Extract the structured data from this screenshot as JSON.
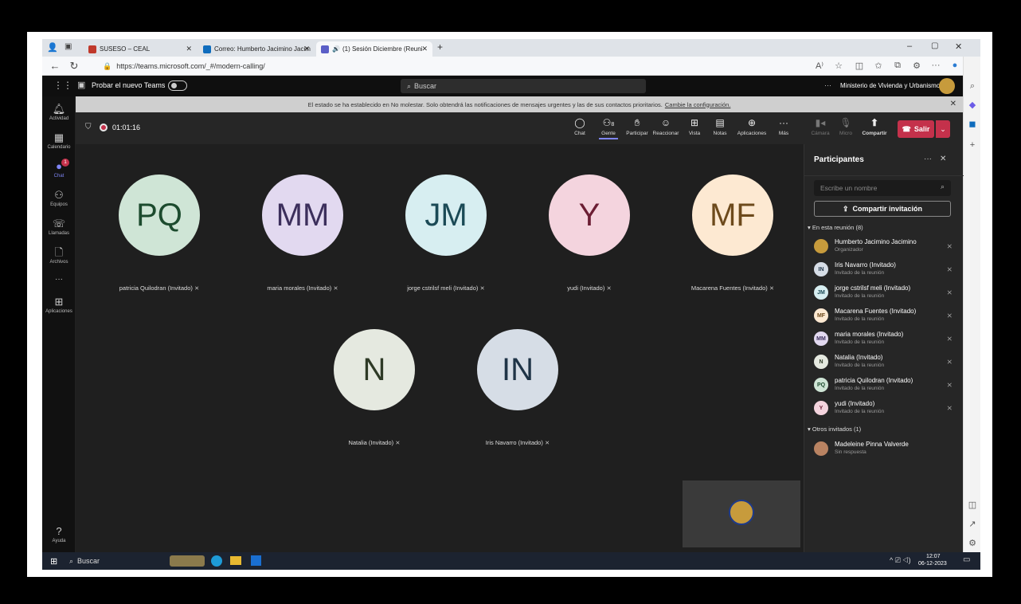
{
  "browser": {
    "tabs": [
      {
        "title": "SUSESO – CEAL"
      },
      {
        "title": "Correo: Humberto Jacimino Jacim"
      },
      {
        "title": "(1) Sesión Diciembre (Reuni"
      }
    ],
    "url": "https://teams.microsoft.com/_#/modern-calling/"
  },
  "teams": {
    "try_new": "Probar el nuevo Teams",
    "search_placeholder": "Buscar",
    "org": "Ministerio de Vivienda y Urbanismo",
    "more": "···"
  },
  "notice": {
    "text": "El estado se ha establecido en No molestar. Solo obtendrá las notificaciones de mensajes urgentes y las de sus contactos prioritarios.",
    "link": "Cambie la configuración."
  },
  "rail": [
    {
      "label": "Actividad",
      "icon": "bell-icon"
    },
    {
      "label": "Calendario",
      "icon": "calendar-icon"
    },
    {
      "label": "Chat",
      "icon": "chat-icon",
      "badge": "1"
    },
    {
      "label": "Equipos",
      "icon": "teams-icon"
    },
    {
      "label": "Llamadas",
      "icon": "phone-icon"
    },
    {
      "label": "Archivos",
      "icon": "file-icon"
    },
    {
      "label": "···",
      "icon": "more-icon"
    },
    {
      "label": "Aplicaciones",
      "icon": "apps-icon"
    },
    {
      "label": "Ayuda",
      "icon": "help-icon"
    }
  ],
  "meeting": {
    "timer": "01:01:16",
    "toolbar": [
      {
        "label": "Chat",
        "glyph": "💬"
      },
      {
        "label": "Gente",
        "glyph": "👥",
        "count": "8"
      },
      {
        "label": "Participar",
        "glyph": "✋"
      },
      {
        "label": "Reaccionar",
        "glyph": "☺"
      },
      {
        "label": "Vista",
        "glyph": "⊞"
      },
      {
        "label": "Notas",
        "glyph": "▤"
      },
      {
        "label": "Aplicaciones",
        "glyph": "⊕"
      },
      {
        "label": "Más",
        "glyph": "···"
      }
    ],
    "device_buttons": [
      {
        "label": "Cámara",
        "glyph": "▮◂"
      },
      {
        "label": "Micro",
        "glyph": "🎙"
      },
      {
        "label": "Compartir",
        "glyph": "⬆"
      }
    ],
    "leave": "Salir",
    "tiles": [
      {
        "initials": "PQ",
        "name": "patricia Quilodran (Invitado)",
        "bg": "#cfe5d6",
        "fg": "#1c4b2e"
      },
      {
        "initials": "MM",
        "name": "maria morales (Invitado)",
        "bg": "#e2d9f0",
        "fg": "#3c2f5c"
      },
      {
        "initials": "JM",
        "name": "jorge cstrilsf meli (Invitado)",
        "bg": "#d7eef1",
        "fg": "#1b4a56"
      },
      {
        "initials": "Y",
        "name": "yudi (Invitado)",
        "bg": "#f4d4de",
        "fg": "#6b1d33"
      },
      {
        "initials": "MF",
        "name": "Macarena Fuentes (Invitado)",
        "bg": "#fde9d2",
        "fg": "#6d4a1c"
      },
      {
        "initials": "N",
        "name": "Natalia (Invitado)",
        "bg": "#e5e9e0",
        "fg": "#2e3a26"
      },
      {
        "initials": "IN",
        "name": "Iris Navarro (Invitado)",
        "bg": "#d6dde6",
        "fg": "#1f3447"
      }
    ]
  },
  "panel": {
    "title": "Participantes",
    "search_placeholder": "Escribe un nombre",
    "share_invite": "Compartir invitación",
    "in_meeting": "En esta reunión (8)",
    "participants": [
      {
        "initials": "",
        "name": "Humberto Jacimino Jacimino",
        "role": "Organizador",
        "bg": "#c79b3c",
        "fg": "#fff"
      },
      {
        "initials": "IN",
        "name": "Iris Navarro (Invitado)",
        "role": "Invitado de la reunión",
        "bg": "#d6dde6",
        "fg": "#1f3447"
      },
      {
        "initials": "JM",
        "name": "jorge cstrilsf meli (Invitado)",
        "role": "Invitado de la reunión",
        "bg": "#d7eef1",
        "fg": "#1b4a56"
      },
      {
        "initials": "MF",
        "name": "Macarena Fuentes (Invitado)",
        "role": "Invitado de la reunión",
        "bg": "#fde9d2",
        "fg": "#6d4a1c"
      },
      {
        "initials": "MM",
        "name": "maria morales (Invitado)",
        "role": "Invitado de la reunión",
        "bg": "#e2d9f0",
        "fg": "#3c2f5c"
      },
      {
        "initials": "N",
        "name": "Natalia (Invitado)",
        "role": "Invitado de la reunión",
        "bg": "#e5e9e0",
        "fg": "#2e3a26"
      },
      {
        "initials": "PQ",
        "name": "patricia Quilodran (Invitado)",
        "role": "Invitado de la reunión",
        "bg": "#cfe5d6",
        "fg": "#1c4b2e"
      },
      {
        "initials": "Y",
        "name": "yudi (Invitado)",
        "role": "Invitado de la reunión",
        "bg": "#f4d4de",
        "fg": "#6b1d33"
      }
    ],
    "others": "Otros invitados (1)",
    "other_people": [
      {
        "name": "Madeleine Pinna Valverde",
        "status": "Sin respuesta"
      }
    ]
  },
  "taskbar": {
    "search": "Buscar",
    "time": "12:07",
    "date": "06-12-2023"
  }
}
